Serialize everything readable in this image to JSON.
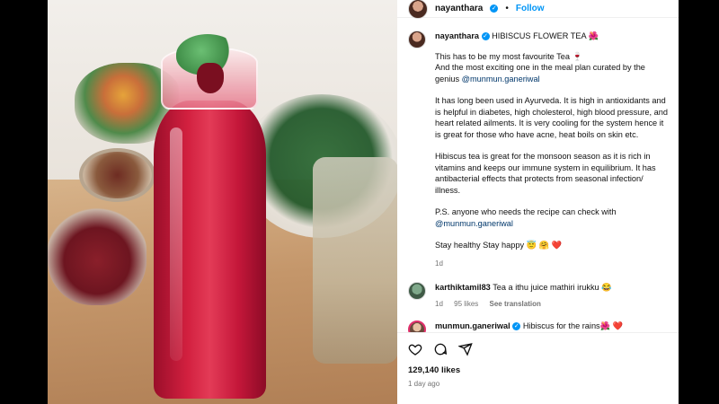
{
  "header": {
    "username": "nayanthara",
    "separator": "•",
    "follow_label": "Follow"
  },
  "caption": {
    "username": "nayanthara",
    "title": "HIBISCUS FLOWER TEA 🌺",
    "paragraphs": [
      "This has to be my most favourite Tea 🍷",
      "And the most exciting one in the meal plan curated by the genius",
      "It has long been used in Ayurveda. It is high in antioxidants and is helpful in diabetes, high cholesterol, high blood pressure, and heart related ailments. It is very cooling for the system hence it is great for those who have acne, heat boils on skin etc.",
      "Hibiscus tea is great for the monsoon season as it is rich in vitamins and keeps our immune system in equilibrium. It has antibacterial effects that protects from seasonal infection/ illness.",
      "P.S. anyone who needs the recipe can check with",
      "Stay healthy Stay happy 😇 🤗 ❤️"
    ],
    "mention": "@munmun.ganeriwal",
    "time": "1d"
  },
  "comments": [
    {
      "username": "karthiktamil83",
      "text": "Tea a ithu juice mathiri irukku 😂",
      "time": "1d",
      "likes": "95 likes",
      "translate": "See translation"
    },
    {
      "username": "munmun.ganeriwal",
      "text": "Hibiscus for the rains🌺 ❤️"
    }
  ],
  "actions": {
    "likes": "129,140 likes",
    "posted": "1 day ago"
  },
  "colors": {
    "accent": "#0095f6",
    "mention": "#00376b",
    "secondary_text": "#737373"
  }
}
